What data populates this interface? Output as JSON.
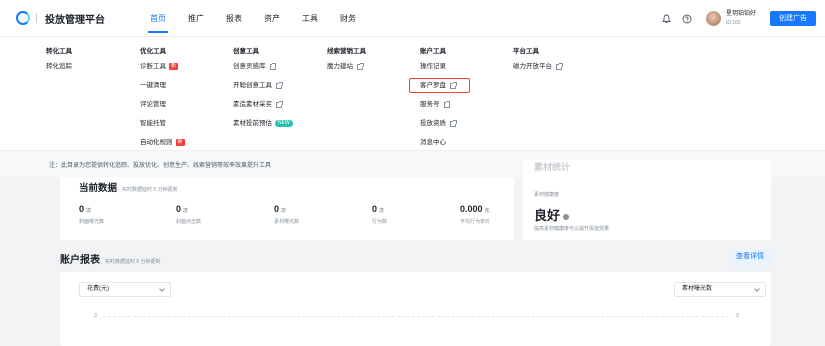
{
  "brand": {
    "title": "投放管理平台"
  },
  "nav": {
    "items": [
      {
        "label": "首页",
        "active": true
      },
      {
        "label": "推广",
        "active": false
      },
      {
        "label": "报表",
        "active": false
      },
      {
        "label": "资产",
        "active": false
      },
      {
        "label": "工具",
        "active": false
      },
      {
        "label": "财务",
        "active": false
      }
    ]
  },
  "header": {
    "icons": [
      "bell-icon",
      "help-icon"
    ],
    "user_name": "星玥铂铂好",
    "user_id": "ID:100",
    "create_button": "创建广告"
  },
  "menu": {
    "columns": [
      {
        "title": "转化工具",
        "items": [
          {
            "label": "转化追踪",
            "ext": false
          }
        ]
      },
      {
        "title": "优化工具",
        "items": [
          {
            "label": "诊断工具",
            "badge": "新"
          },
          {
            "label": "一键清理"
          },
          {
            "label": "评论管理"
          },
          {
            "label": "智能托管"
          },
          {
            "label": "自动化规则",
            "badge": "新"
          }
        ]
      },
      {
        "title": "创意工具",
        "items": [
          {
            "label": "创意灵感库",
            "ext": true
          },
          {
            "label": "开聪创意工具",
            "ext": true
          },
          {
            "label": "素造素材采买",
            "ext": true
          },
          {
            "label": "素材投前预估",
            "badge_hot": "NEW"
          }
        ]
      },
      {
        "title": "线索营销工具",
        "items": [
          {
            "label": "魔力建站",
            "ext": true
          }
        ]
      },
      {
        "title": "账户工具",
        "items": [
          {
            "label": "操作记录"
          },
          {
            "label": "客户罗盘",
            "ext": true
          },
          {
            "label": "服务号",
            "ext": true
          },
          {
            "label": "投放资质",
            "ext": true
          },
          {
            "label": "消息中心"
          }
        ]
      },
      {
        "title": "平台工具",
        "items": [
          {
            "label": "磁力开放平台",
            "ext": true
          }
        ]
      }
    ],
    "note": "注：此目录为您提供转化追踪、投放优化、创意生产、线索营销等效率效果提升工具"
  },
  "current_data": {
    "title": "当前数据",
    "subnote": "实时数据延时 5 分钟更新",
    "stats": [
      {
        "value": "0",
        "unit": "次",
        "label": "封面曝光数"
      },
      {
        "value": "0",
        "unit": "次",
        "label": "封面点击数"
      },
      {
        "value": "0",
        "unit": "次",
        "label": "素材曝光数"
      },
      {
        "value": "0",
        "unit": "次",
        "label": "行为数"
      },
      {
        "value": "0.000",
        "unit": "元",
        "label": "平均行为单价"
      }
    ]
  },
  "material": {
    "title": "素材统计",
    "label": "素材健康度",
    "value": "良好",
    "sub": "提高素材健康度可以提升投放效果"
  },
  "report": {
    "title": "账户报表",
    "subnote": "实时数据延时 5 分钟更新",
    "detail_button": "查看详情",
    "left_select": "花费(元)",
    "right_select": "素材曝光数",
    "left_axis_tick": "3",
    "right_axis_tick": "3"
  }
}
